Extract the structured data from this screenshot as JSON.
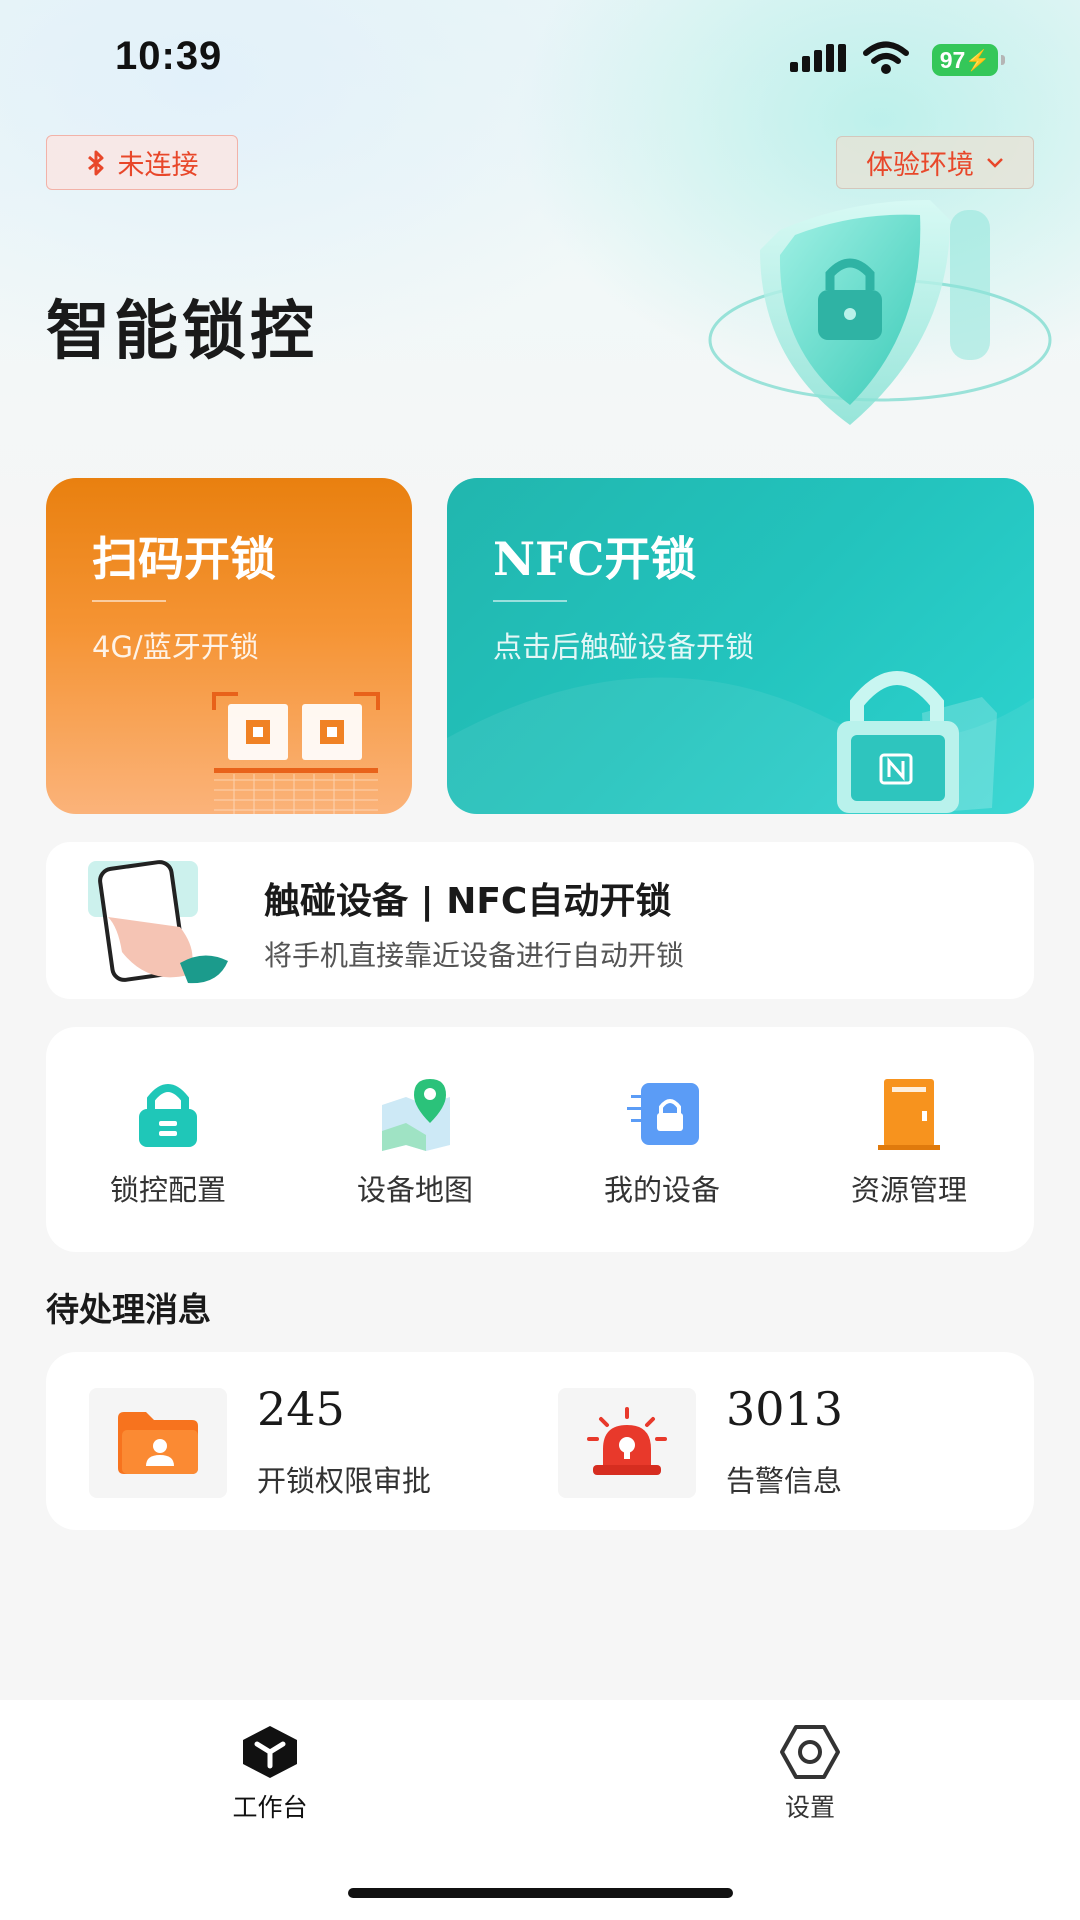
{
  "status_bar": {
    "time": "10:39",
    "battery": "97"
  },
  "header": {
    "bluetooth_status": "未连接",
    "environment": "体验环境",
    "title": "智能锁控"
  },
  "actions": {
    "scan": {
      "title": "扫码开锁",
      "subtitle": "4G/蓝牙开锁"
    },
    "nfc": {
      "title": "NFC开锁",
      "subtitle": "点击后触碰设备开锁"
    }
  },
  "touch_banner": {
    "title": "触碰设备 | NFC自动开锁",
    "subtitle": "将手机直接靠近设备进行自动开锁"
  },
  "menu": {
    "items": [
      {
        "label": "锁控配置",
        "icon": "lock-config-icon",
        "color": "#1fc7b8"
      },
      {
        "label": "设备地图",
        "icon": "map-pin-icon",
        "color": "#2bc27a"
      },
      {
        "label": "我的设备",
        "icon": "device-lock-icon",
        "color": "#5b9cf6"
      },
      {
        "label": "资源管理",
        "icon": "door-icon",
        "color": "#f7931e"
      }
    ]
  },
  "pending": {
    "title": "待处理消息",
    "items": [
      {
        "count": "245",
        "label": "开锁权限审批",
        "icon": "folder-user-icon",
        "color": "#f7731e"
      },
      {
        "count": "3013",
        "label": "告警信息",
        "icon": "alarm-siren-icon",
        "color": "#e8392b"
      }
    ]
  },
  "tabs": [
    {
      "label": "工作台",
      "icon": "workbench-icon",
      "active": true
    },
    {
      "label": "设置",
      "icon": "settings-icon",
      "active": false
    }
  ]
}
